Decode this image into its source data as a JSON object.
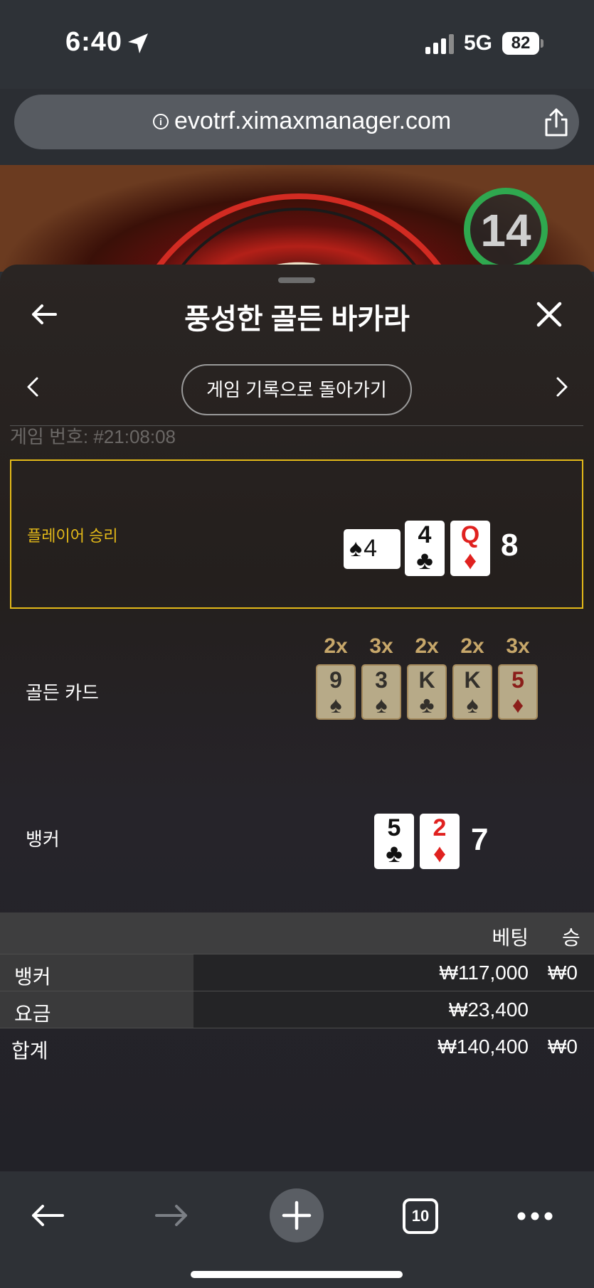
{
  "status": {
    "time": "6:40",
    "network": "5G",
    "battery": "82"
  },
  "browser": {
    "url": "evotrf.ximaxmanager.com",
    "tabs_count": "10"
  },
  "game": {
    "timer": "14"
  },
  "sheet": {
    "title": "풍성한 골든 바카라",
    "history_button": "게임 기록으로 돌아가기",
    "game_number": "게임 번호: #21:08:08"
  },
  "player": {
    "label": "플레이어 승리",
    "cards": [
      {
        "rank": "♠4",
        "suit": "",
        "color": "black",
        "sideways": true
      },
      {
        "rank": "4",
        "suit": "♣",
        "color": "black",
        "sideways": false
      },
      {
        "rank": "Q",
        "suit": "♦",
        "color": "red",
        "sideways": false
      }
    ],
    "score": "8"
  },
  "golden": {
    "label": "골든 카드",
    "cards": [
      {
        "mult": "2x",
        "rank": "9",
        "suit": "♠",
        "color": "black"
      },
      {
        "mult": "3x",
        "rank": "3",
        "suit": "♠",
        "color": "black"
      },
      {
        "mult": "2x",
        "rank": "K",
        "suit": "♣",
        "color": "black"
      },
      {
        "mult": "2x",
        "rank": "K",
        "suit": "♠",
        "color": "black"
      },
      {
        "mult": "3x",
        "rank": "5",
        "suit": "♦",
        "color": "red"
      }
    ]
  },
  "banker": {
    "label": "뱅커",
    "cards": [
      {
        "rank": "5",
        "suit": "♣",
        "color": "black"
      },
      {
        "rank": "2",
        "suit": "♦",
        "color": "red"
      }
    ],
    "score": "7"
  },
  "bets": {
    "header_bet": "베팅",
    "header_win": "승",
    "rows": [
      {
        "name": "뱅커",
        "amount": "₩117,000",
        "win": "₩0"
      },
      {
        "name": "요금",
        "amount": "₩23,400",
        "win": ""
      }
    ],
    "total": {
      "name": "합계",
      "amount": "₩140,400",
      "win": "₩0"
    }
  },
  "colors": {
    "accent_gold": "#e3b919",
    "timer_green": "#2fa84f",
    "card_red": "#e0211f"
  }
}
